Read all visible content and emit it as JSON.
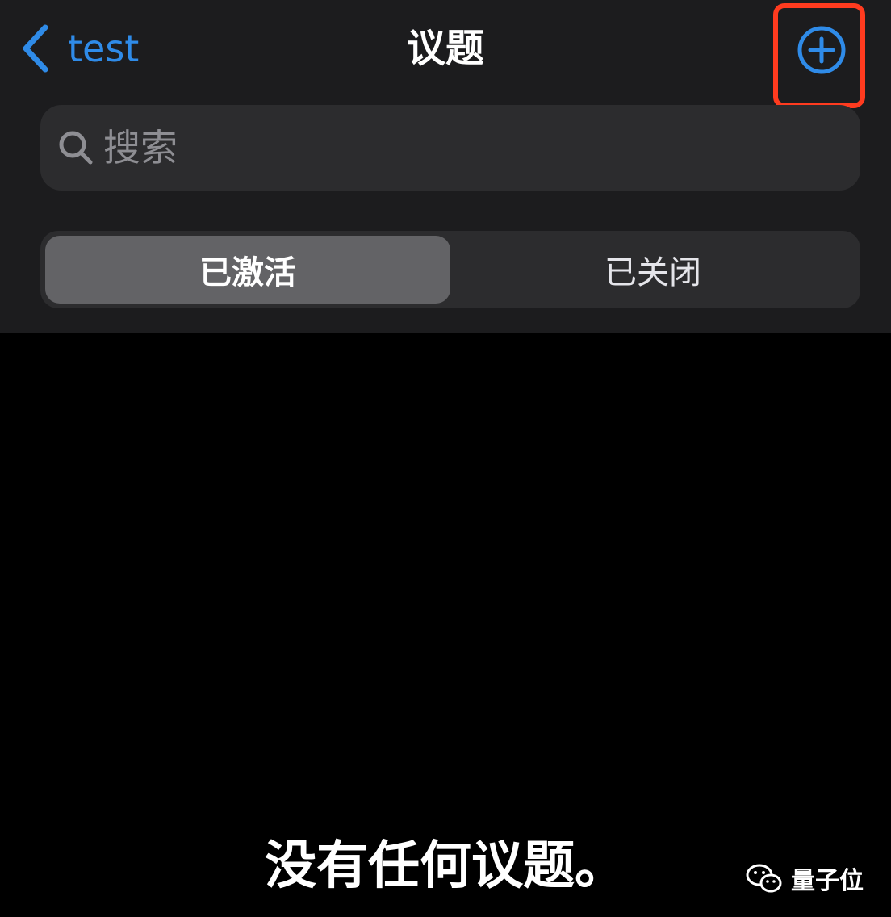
{
  "nav": {
    "back_label": "test",
    "title": "议题",
    "back_icon": "chevron-left-icon",
    "add_icon": "plus-circle-icon",
    "highlight_color": "#ff3b1f",
    "accent_color": "#2f8be8"
  },
  "search": {
    "placeholder": "搜索",
    "value": "",
    "icon": "search-icon"
  },
  "segments": {
    "items": [
      {
        "label": "已激活",
        "selected": true
      },
      {
        "label": "已关闭",
        "selected": false
      }
    ]
  },
  "content": {
    "empty_message": "没有任何议题。"
  },
  "watermark": {
    "text": "量子位",
    "icon": "wechat-icon"
  }
}
